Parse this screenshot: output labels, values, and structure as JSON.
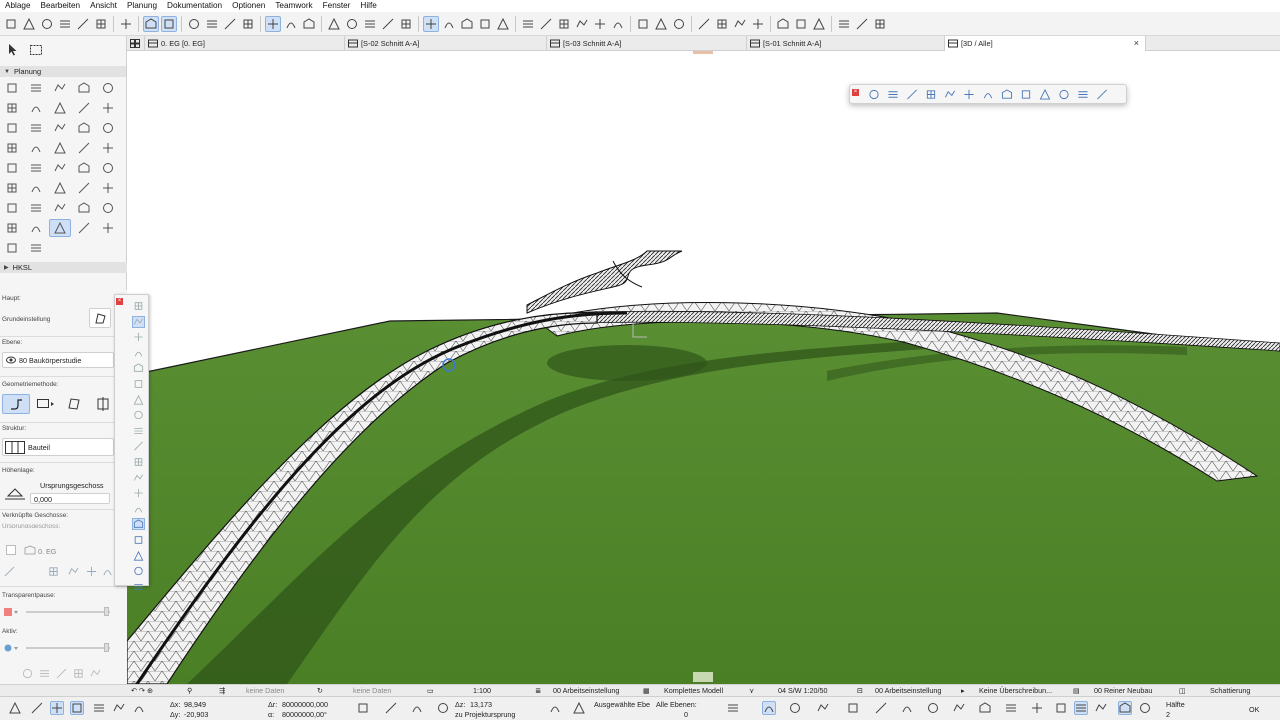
{
  "menu": [
    "Ablage",
    "Bearbeiten",
    "Ansicht",
    "Planung",
    "Dokumentation",
    "Optionen",
    "Teamwork",
    "Fenster",
    "Hilfe"
  ],
  "tabs": [
    {
      "label": "0. EG [0. EG]",
      "icon": "floorplan-icon"
    },
    {
      "label": "[S-02 Schnitt A-A]",
      "icon": "section-icon"
    },
    {
      "label": "[S-03 Schnitt A-A]",
      "icon": "section-icon"
    },
    {
      "label": "[S-01 Schnitt A-A]",
      "icon": "section-icon"
    },
    {
      "label": "[3D / Alle]",
      "icon": "3d-window-icon",
      "active": true
    }
  ],
  "toolbox": {
    "sections": {
      "planung": "Planung",
      "hksl": "HKSL"
    }
  },
  "infobox": {
    "haupt": "Haupt:",
    "grundeinstellung": "Grundeinstellung",
    "ebene_label": "Ebene:",
    "ebene_value": "80 Baukörperstudie",
    "geometriemethode": "Geometriemethode:",
    "struktur_label": "Struktur:",
    "struktur_value": "Bauteil",
    "hoehenlage": "Höhenlage:",
    "ursprungsgeschoss": "Ursprungsgeschoss",
    "offset": "0,000",
    "verknuepfte": "Verknüpfte Geschosse:",
    "ursprungsgeschoss2": "Ursprungsgeschoss:",
    "geschoss": "0. EG",
    "transparentpause": "Transparentpause:",
    "aktiv": "Aktiv:"
  },
  "statusbar": {
    "keine_daten_1": "keine Daten",
    "keine_daten_2": "keine Daten",
    "scale": "1:100",
    "arbeitseinstellung_1": "00 Arbeitseinstellung",
    "modell": "Komplettes Modell",
    "pen_set": "04 S/W 1:20/50",
    "arbeitseinstellung_2": "00 Arbeitseinstellung",
    "ueberschreibung": "Keine Überschreibun...",
    "renovierung": "00 Reiner Neubau",
    "schattierung": "Schattierung"
  },
  "coords": {
    "dx_label": "Δx:",
    "dx": "98,949",
    "dy_label": "Δy:",
    "dy": "-20,903",
    "dr_label": "Δr:",
    "dr": "80000000,000",
    "da_label": "α:",
    "da": "80000000,00°",
    "dz_label": "Δz:",
    "dz": "13,173",
    "projektursprung": "zu Projektursprung",
    "ausgewaehlte_ebene": "Ausgewählte Ebe",
    "alle_ebenen": "Alle Ebenen:",
    "count": "0",
    "haelfte": "Hälfte",
    "haelfte_num": "2",
    "ok": "OK"
  },
  "colors": {
    "accent": "#cfe0f6",
    "accent_border": "#8db2e0",
    "terrain": "#4e8629",
    "terrain_dark": "#3e6f1f",
    "shadow": "#2f5519",
    "road": "#f2f2f2"
  }
}
